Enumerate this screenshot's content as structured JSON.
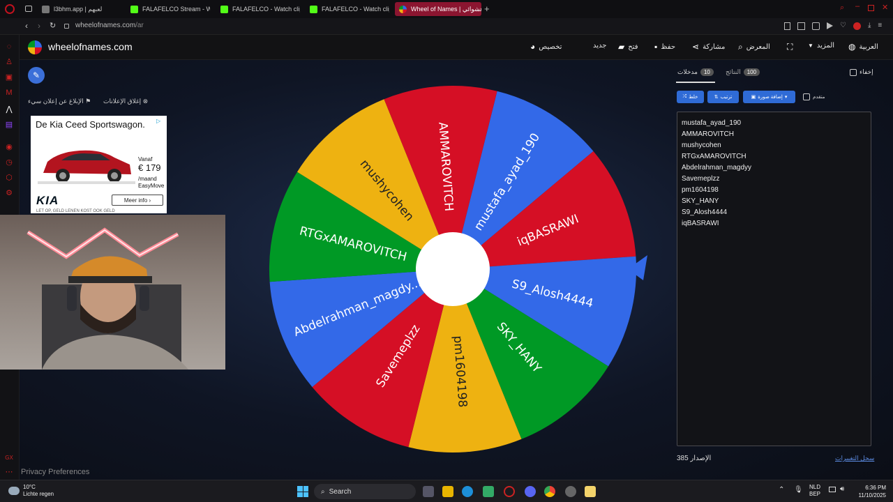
{
  "browser": {
    "tabs": [
      {
        "label": "l3bhm.app | لعبهم",
        "color": "#888888"
      },
      {
        "label": "FALAFELCO Stream - Wat",
        "color": "#53fc18"
      },
      {
        "label": "FALAFELCO - Watch clip",
        "color": "#53fc18"
      },
      {
        "label": "FALAFELCO - Watch clip",
        "color": "#53fc18"
      },
      {
        "label": "Wheel of Names | عشوائي",
        "color": "#e8303f"
      }
    ],
    "url_host": "wheelofnames.com",
    "url_path": "/ar"
  },
  "site": {
    "logo_text": "wheelofnames.com",
    "menu": {
      "customize": "تخصيص",
      "new": "جديد",
      "open": "فتح",
      "save": "حفظ",
      "share": "مشاركة",
      "gallery": "المعرض",
      "more": "المزيد",
      "language": "العربية"
    }
  },
  "ads": {
    "close_ads": "إغلاق الإعلانات",
    "report_ad": "الإبلاغ عن إعلان سيء",
    "title": "De Kia Ceed Sportswagon.",
    "from": "Vanaf",
    "price": "€ 179",
    "per_month": "/maand",
    "plan": "EasyMove",
    "button": "Meer info",
    "brand": "KIA",
    "small_print": "LET OP, GELD LENEN KOST OOK GELD"
  },
  "wheel": {
    "segments": [
      {
        "name": "mustafa_ayad_190",
        "color": "#3369e8"
      },
      {
        "name": "iqBASRAWI",
        "color": "#d50f25"
      },
      {
        "name": "S9_Alosh4444",
        "color": "#3369e8"
      },
      {
        "name": "SKY_HANY",
        "color": "#009925"
      },
      {
        "name": "pm1604198",
        "color": "#eeb211"
      },
      {
        "name": "Savemeplzz",
        "color": "#d50f25"
      },
      {
        "name": "Abdelrahman_magdy...",
        "color": "#3369e8"
      },
      {
        "name": "RTGxAMAROVITCH",
        "color": "#009925"
      },
      {
        "name": "mushycohen",
        "color": "#eeb211"
      },
      {
        "name": "AMMAROVITCH",
        "color": "#d50f25"
      }
    ],
    "pointer_color": "#3369e8"
  },
  "panel": {
    "hide_label": "إخفاء",
    "results_label": "النتائج",
    "results_count": "100",
    "entries_label": "مدخلات",
    "entries_count": "10",
    "shuffle": "خلط",
    "sort": "ترتيب",
    "add_image": "إضافة صورة",
    "advanced": "متقدم",
    "entries": [
      "mustafa_ayad_190",
      "AMMAROVITCH",
      "mushycohen",
      "RTGxAMAROVITCH",
      "Abdelrahman_magdyy",
      "Savemeplzz",
      "pm1604198",
      "SKY_HANY",
      "S9_Alosh4444",
      "iqBASRAWI"
    ],
    "version_label": "الإصدار",
    "version": "385",
    "changelog": "سجل التغييرات"
  },
  "privacy": "Privacy Preferences",
  "taskbar": {
    "temp": "10°C",
    "weather": "Lichte regen",
    "search": "Search",
    "lang1": "NLD",
    "lang2": "BEP",
    "time": "6:36 PM",
    "date": "11/10/2025"
  }
}
